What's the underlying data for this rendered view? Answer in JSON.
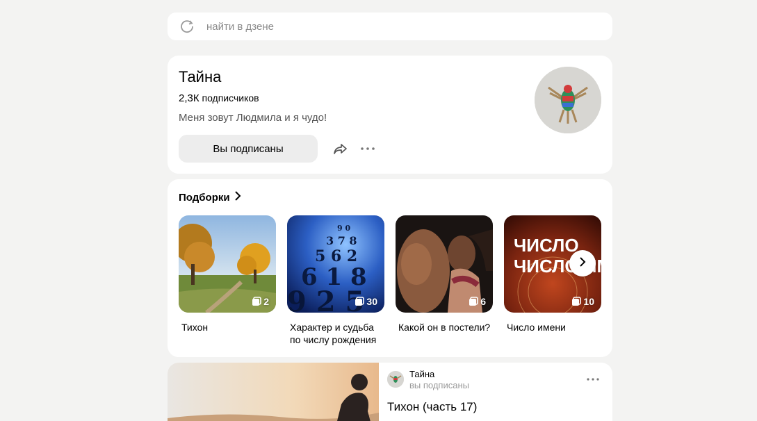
{
  "search": {
    "placeholder": "найти в дзене",
    "icon": "zen-logo-icon"
  },
  "channel": {
    "name": "Тайна",
    "subscribers_count": "2,3К",
    "subscribers_label": "подписчиков",
    "description": "Меня зовут Людмила и я чудо!",
    "subscribe_button": "Вы подписаны",
    "share_icon": "share-arrow-icon",
    "more_icon": "more-dots-icon"
  },
  "collections": {
    "header": "Подборки",
    "items": [
      {
        "title": "Тихон",
        "count": "2"
      },
      {
        "title": "Характер и судьба по числу рождения",
        "count": "30"
      },
      {
        "title": "Какой он в постели?",
        "count": "6"
      },
      {
        "title": "Число имени",
        "count": "10",
        "image_text": "ЧИСЛО ИМЕН"
      }
    ]
  },
  "post": {
    "author": "Тайна",
    "status": "вы подписаны",
    "title": "Тихон (часть 17)"
  },
  "colors": {
    "page_bg": "#f3f3f2",
    "card_bg": "#ffffff",
    "button_bg": "#ededed",
    "muted_text": "#8a8a8a"
  }
}
